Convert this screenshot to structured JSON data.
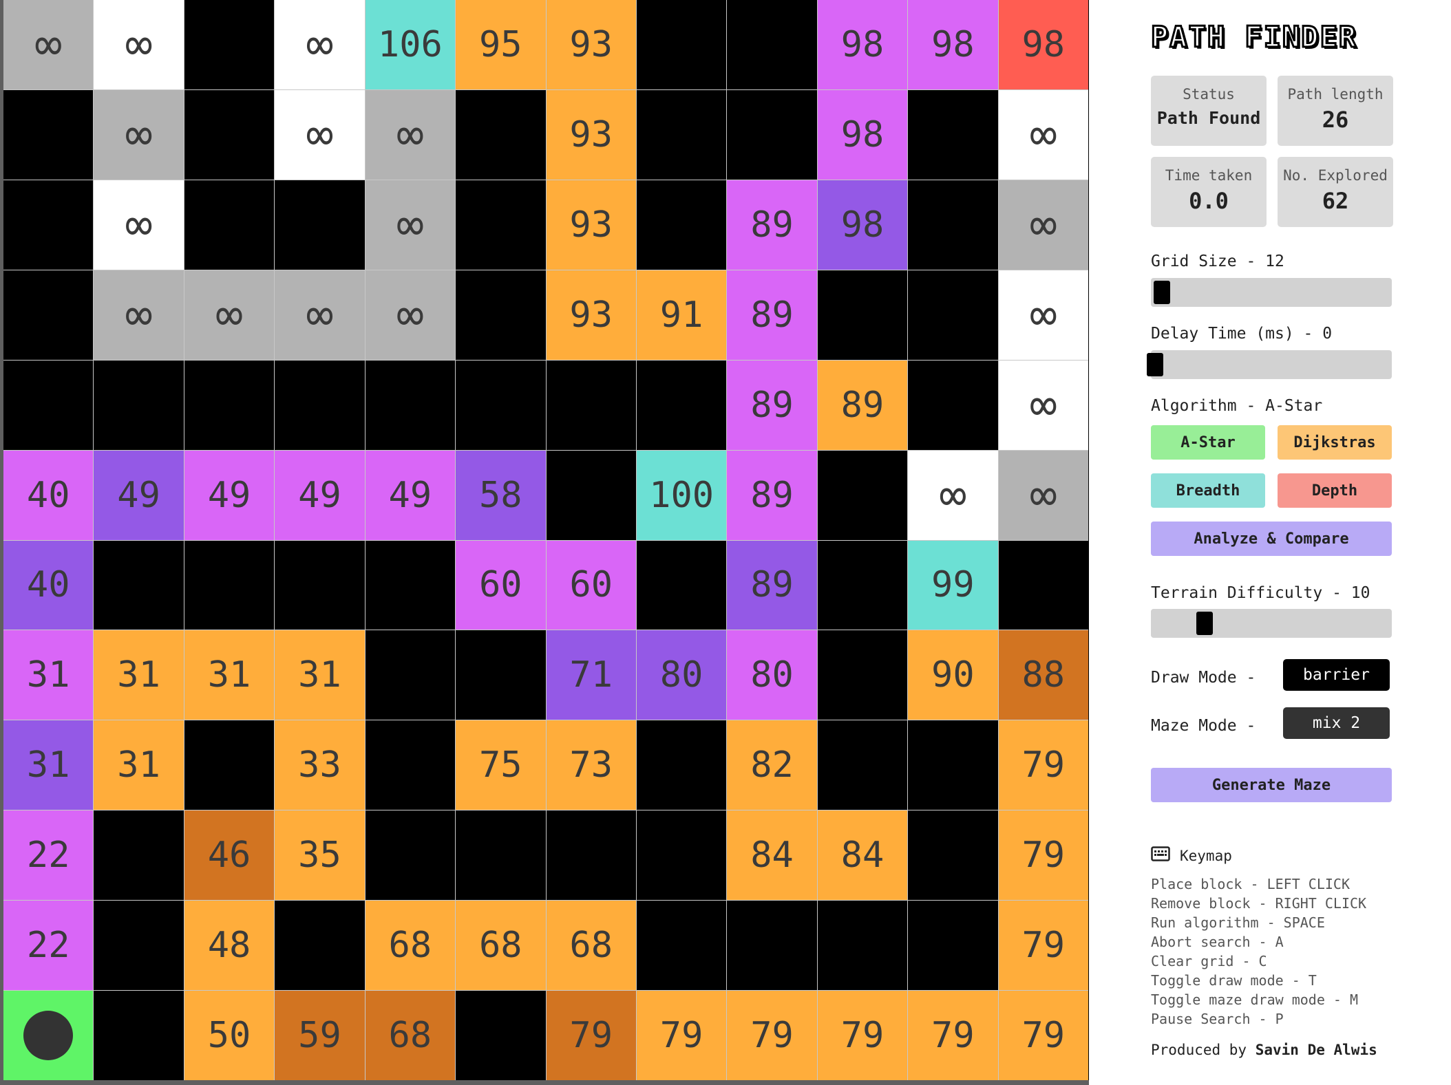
{
  "app": {
    "title": "PATH FINDER"
  },
  "stats": {
    "status_label": "Status",
    "status_value": "Path Found",
    "path_length_label": "Path length",
    "path_length_value": "26",
    "time_label": "Time taken",
    "time_value": "0.0",
    "explored_label": "No. Explored",
    "explored_value": "62"
  },
  "controls": {
    "grid_size_label": "Grid Size - 12",
    "grid_size_value": 12,
    "delay_label": "Delay Time (ms) - 0",
    "delay_value": 0,
    "algorithm_label": "Algorithm - A-Star",
    "algorithms": [
      {
        "label": "A-Star",
        "color": "#98ee97"
      },
      {
        "label": "Dijkstras",
        "color": "#fdc676"
      },
      {
        "label": "Breadth",
        "color": "#8fe0da"
      },
      {
        "label": "Depth",
        "color": "#f7978f"
      }
    ],
    "analyze_label": "Analyze & Compare",
    "terrain_label": "Terrain Difficulty - 10",
    "terrain_value": 10,
    "draw_mode_label": "Draw Mode -",
    "draw_mode_value": "barrier",
    "maze_mode_label": "Maze Mode -",
    "maze_mode_value": "mix 2",
    "generate_label": "Generate Maze"
  },
  "keymap": {
    "title": "Keymap",
    "items": [
      "Place block - LEFT CLICK",
      "Remove block - RIGHT CLICK",
      "Run algorithm - SPACE",
      "Abort search - A",
      "Clear grid - C",
      "Toggle draw mode - T",
      "Toggle maze draw mode - M",
      "Pause Search - P"
    ]
  },
  "credit": {
    "prefix": "Produced by",
    "author": "Savin De Alwis"
  },
  "grid": {
    "size": 12,
    "rows": [
      [
        {
          "t": "frontier",
          "v": "∞"
        },
        {
          "t": "unexplored",
          "v": "∞"
        },
        {
          "t": "barrier",
          "v": ""
        },
        {
          "t": "unexplored",
          "v": "∞"
        },
        {
          "t": "teal",
          "v": "106"
        },
        {
          "t": "path",
          "v": "95"
        },
        {
          "t": "path",
          "v": "93"
        },
        {
          "t": "barrier",
          "v": ""
        },
        {
          "t": "barrier",
          "v": ""
        },
        {
          "t": "explored",
          "v": "98"
        },
        {
          "t": "explored",
          "v": "98"
        },
        {
          "t": "end",
          "v": "98"
        }
      ],
      [
        {
          "t": "barrier",
          "v": ""
        },
        {
          "t": "frontier",
          "v": "∞"
        },
        {
          "t": "barrier",
          "v": ""
        },
        {
          "t": "unexplored",
          "v": "∞"
        },
        {
          "t": "frontier",
          "v": "∞"
        },
        {
          "t": "barrier",
          "v": ""
        },
        {
          "t": "path",
          "v": "93"
        },
        {
          "t": "barrier",
          "v": ""
        },
        {
          "t": "barrier",
          "v": ""
        },
        {
          "t": "explored",
          "v": "98"
        },
        {
          "t": "barrier",
          "v": ""
        },
        {
          "t": "unexplored",
          "v": "∞"
        }
      ],
      [
        {
          "t": "barrier",
          "v": ""
        },
        {
          "t": "unexplored",
          "v": "∞"
        },
        {
          "t": "barrier",
          "v": ""
        },
        {
          "t": "barrier",
          "v": ""
        },
        {
          "t": "frontier",
          "v": "∞"
        },
        {
          "t": "barrier",
          "v": ""
        },
        {
          "t": "path",
          "v": "93"
        },
        {
          "t": "barrier",
          "v": ""
        },
        {
          "t": "explored",
          "v": "89"
        },
        {
          "t": "explored2",
          "v": "98"
        },
        {
          "t": "barrier",
          "v": ""
        },
        {
          "t": "frontier",
          "v": "∞"
        }
      ],
      [
        {
          "t": "barrier",
          "v": ""
        },
        {
          "t": "frontier",
          "v": "∞"
        },
        {
          "t": "frontier",
          "v": "∞"
        },
        {
          "t": "frontier",
          "v": "∞"
        },
        {
          "t": "frontier",
          "v": "∞"
        },
        {
          "t": "barrier",
          "v": ""
        },
        {
          "t": "path",
          "v": "93"
        },
        {
          "t": "path",
          "v": "91"
        },
        {
          "t": "explored",
          "v": "89"
        },
        {
          "t": "barrier",
          "v": ""
        },
        {
          "t": "barrier",
          "v": ""
        },
        {
          "t": "unexplored",
          "v": "∞"
        }
      ],
      [
        {
          "t": "barrier",
          "v": ""
        },
        {
          "t": "barrier",
          "v": ""
        },
        {
          "t": "barrier",
          "v": ""
        },
        {
          "t": "barrier",
          "v": ""
        },
        {
          "t": "barrier",
          "v": ""
        },
        {
          "t": "barrier",
          "v": ""
        },
        {
          "t": "barrier",
          "v": ""
        },
        {
          "t": "barrier",
          "v": ""
        },
        {
          "t": "explored",
          "v": "89"
        },
        {
          "t": "path",
          "v": "89"
        },
        {
          "t": "barrier",
          "v": ""
        },
        {
          "t": "unexplored",
          "v": "∞"
        }
      ],
      [
        {
          "t": "explored",
          "v": "40"
        },
        {
          "t": "explored2",
          "v": "49"
        },
        {
          "t": "explored",
          "v": "49"
        },
        {
          "t": "explored",
          "v": "49"
        },
        {
          "t": "explored",
          "v": "49"
        },
        {
          "t": "explored2",
          "v": "58"
        },
        {
          "t": "barrier",
          "v": ""
        },
        {
          "t": "teal",
          "v": "100"
        },
        {
          "t": "explored",
          "v": "89"
        },
        {
          "t": "barrier",
          "v": ""
        },
        {
          "t": "unexplored",
          "v": "∞"
        },
        {
          "t": "frontier",
          "v": "∞"
        }
      ],
      [
        {
          "t": "explored2",
          "v": "40"
        },
        {
          "t": "barrier",
          "v": ""
        },
        {
          "t": "barrier",
          "v": ""
        },
        {
          "t": "barrier",
          "v": ""
        },
        {
          "t": "barrier",
          "v": ""
        },
        {
          "t": "explored",
          "v": "60"
        },
        {
          "t": "explored",
          "v": "60"
        },
        {
          "t": "barrier",
          "v": ""
        },
        {
          "t": "explored2",
          "v": "89"
        },
        {
          "t": "barrier",
          "v": ""
        },
        {
          "t": "teal",
          "v": "99"
        },
        {
          "t": "barrier",
          "v": ""
        }
      ],
      [
        {
          "t": "explored",
          "v": "31"
        },
        {
          "t": "path",
          "v": "31"
        },
        {
          "t": "path",
          "v": "31"
        },
        {
          "t": "path",
          "v": "31"
        },
        {
          "t": "barrier",
          "v": ""
        },
        {
          "t": "barrier",
          "v": ""
        },
        {
          "t": "explored2",
          "v": "71"
        },
        {
          "t": "explored2",
          "v": "80"
        },
        {
          "t": "explored",
          "v": "80"
        },
        {
          "t": "barrier",
          "v": ""
        },
        {
          "t": "path",
          "v": "90"
        },
        {
          "t": "heavy",
          "v": "88"
        }
      ],
      [
        {
          "t": "explored2",
          "v": "31"
        },
        {
          "t": "path",
          "v": "31"
        },
        {
          "t": "barrier",
          "v": ""
        },
        {
          "t": "path",
          "v": "33"
        },
        {
          "t": "barrier",
          "v": ""
        },
        {
          "t": "path",
          "v": "75"
        },
        {
          "t": "path",
          "v": "73"
        },
        {
          "t": "barrier",
          "v": ""
        },
        {
          "t": "path",
          "v": "82"
        },
        {
          "t": "barrier",
          "v": ""
        },
        {
          "t": "barrier",
          "v": ""
        },
        {
          "t": "path",
          "v": "79"
        }
      ],
      [
        {
          "t": "explored",
          "v": "22"
        },
        {
          "t": "barrier",
          "v": ""
        },
        {
          "t": "heavy",
          "v": "46"
        },
        {
          "t": "path",
          "v": "35"
        },
        {
          "t": "barrier",
          "v": ""
        },
        {
          "t": "barrier",
          "v": ""
        },
        {
          "t": "barrier",
          "v": ""
        },
        {
          "t": "barrier",
          "v": ""
        },
        {
          "t": "path",
          "v": "84"
        },
        {
          "t": "path",
          "v": "84"
        },
        {
          "t": "barrier",
          "v": ""
        },
        {
          "t": "path",
          "v": "79"
        }
      ],
      [
        {
          "t": "explored",
          "v": "22"
        },
        {
          "t": "barrier",
          "v": ""
        },
        {
          "t": "path",
          "v": "48"
        },
        {
          "t": "barrier",
          "v": ""
        },
        {
          "t": "path",
          "v": "68"
        },
        {
          "t": "path",
          "v": "68"
        },
        {
          "t": "path",
          "v": "68"
        },
        {
          "t": "barrier",
          "v": ""
        },
        {
          "t": "barrier",
          "v": ""
        },
        {
          "t": "barrier",
          "v": ""
        },
        {
          "t": "barrier",
          "v": ""
        },
        {
          "t": "path",
          "v": "79"
        }
      ],
      [
        {
          "t": "start",
          "v": ""
        },
        {
          "t": "barrier",
          "v": ""
        },
        {
          "t": "path",
          "v": "50"
        },
        {
          "t": "heavy",
          "v": "59"
        },
        {
          "t": "heavy",
          "v": "68"
        },
        {
          "t": "barrier",
          "v": ""
        },
        {
          "t": "heavy",
          "v": "79"
        },
        {
          "t": "path",
          "v": "79"
        },
        {
          "t": "path",
          "v": "79"
        },
        {
          "t": "path",
          "v": "79"
        },
        {
          "t": "path",
          "v": "79"
        },
        {
          "t": "path",
          "v": "79"
        }
      ]
    ]
  }
}
